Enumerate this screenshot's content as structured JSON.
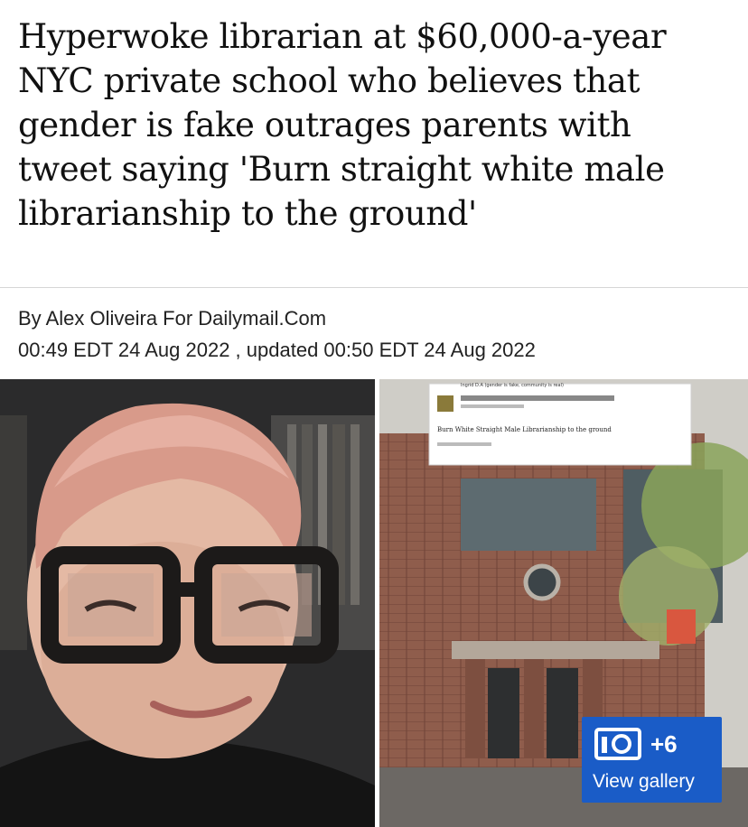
{
  "article": {
    "headline": "Hyperwoke librarian at $60,000-a-year NYC private school who believes that gender is fake outrages parents with tweet saying 'Burn straight white male librarianship to the ground'",
    "byline": "By Alex Oliveira For Dailymail.Com",
    "dateline": "00:49 EDT 24 Aug 2022 , updated 00:50 EDT 24 Aug 2022"
  },
  "tweet_overlay": {
    "name": "Ingrid D.A (gender is fake, community is real)",
    "text": "Burn White Straight Male Librarianship to the ground"
  },
  "gallery": {
    "count": "+6",
    "label": "View gallery",
    "icon": "camera-icon",
    "color": "#1a5cc7"
  }
}
